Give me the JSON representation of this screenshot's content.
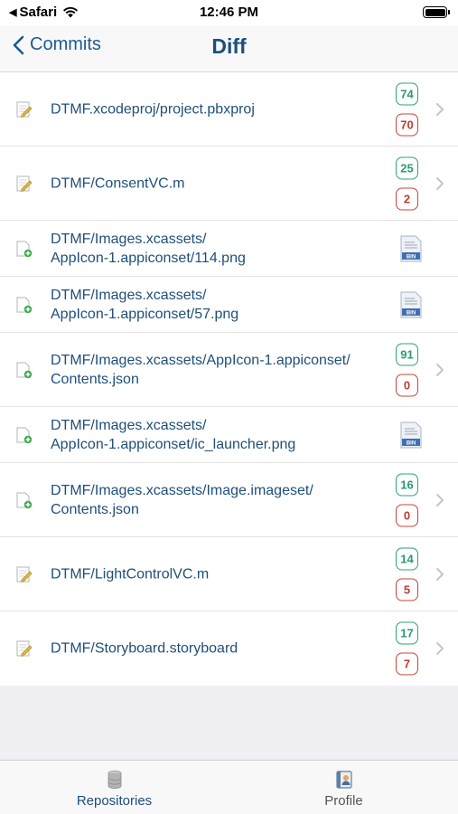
{
  "status_bar": {
    "carrier": "Safari",
    "time": "12:46 PM"
  },
  "nav": {
    "back_label": "Commits",
    "title": "Diff"
  },
  "files": [
    {
      "path": "DTMF.xcodeproj/project.pbxproj",
      "status": "modified",
      "additions": "74",
      "deletions": "70"
    },
    {
      "path": "DTMF/ConsentVC.m",
      "status": "modified",
      "additions": "25",
      "deletions": "2"
    },
    {
      "path": "DTMF/Images.xcassets/\nAppIcon-1.appiconset/114.png",
      "status": "added",
      "binary": true
    },
    {
      "path": "DTMF/Images.xcassets/\nAppIcon-1.appiconset/57.png",
      "status": "added",
      "binary": true
    },
    {
      "path": "DTMF/Images.xcassets/AppIcon-1.appiconset/\nContents.json",
      "status": "added",
      "additions": "91",
      "deletions": "0"
    },
    {
      "path": "DTMF/Images.xcassets/\nAppIcon-1.appiconset/ic_launcher.png",
      "status": "added",
      "binary": true
    },
    {
      "path": "DTMF/Images.xcassets/Image.imageset/\nContents.json",
      "status": "added",
      "additions": "16",
      "deletions": "0"
    },
    {
      "path": "DTMF/LightControlVC.m",
      "status": "modified",
      "additions": "14",
      "deletions": "5"
    },
    {
      "path": "DTMF/Storyboard.storyboard",
      "status": "modified",
      "additions": "17",
      "deletions": "7"
    }
  ],
  "tabs": {
    "repositories": "Repositories",
    "profile": "Profile"
  },
  "colors": {
    "accent": "#1d5c94",
    "additions": "#2ea37a",
    "deletions": "#c8453a"
  }
}
